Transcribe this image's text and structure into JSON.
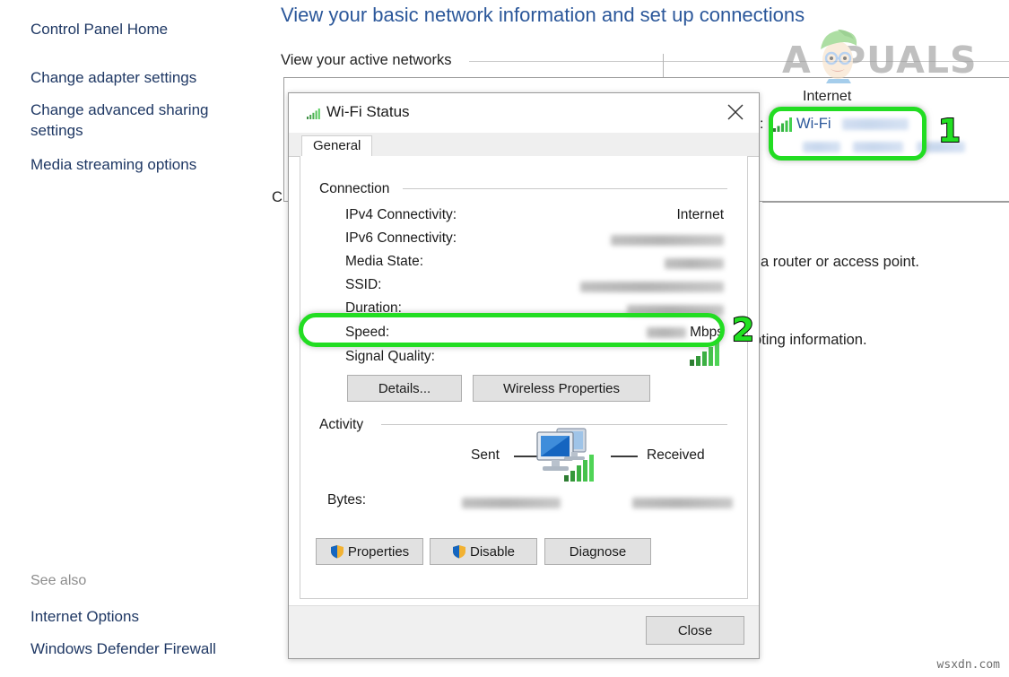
{
  "sidebar": {
    "home_label": "Control Panel Home",
    "links": [
      "Change adapter settings",
      "Change advanced sharing settings",
      "Media streaming options"
    ],
    "see_also_label": "See also",
    "see_also_links": [
      "Internet Options",
      "Windows Defender Firewall"
    ]
  },
  "main": {
    "page_title": "View your basic network information and set up connections",
    "section_heading": "View your active networks",
    "access_type_label": "Internet",
    "connections_colon": ":",
    "wifi_link_label": "Wi-Fi",
    "wifi_name_redacted": "",
    "wifi_sub_redacted": "",
    "behind_dialog_text_1": "a router or access point.",
    "behind_dialog_text_2": "oting information.",
    "left_peek_char": "C"
  },
  "markers": {
    "one": "1",
    "two": "2",
    "color": "#22dd22"
  },
  "dialog": {
    "title": "Wi-Fi Status",
    "title_icon": "wifi-signal-icon",
    "close_icon": "close-icon",
    "tab": "General",
    "groups": {
      "connection": "Connection",
      "activity": "Activity"
    },
    "connection_rows": [
      {
        "label": "IPv4 Connectivity:",
        "value": "Internet",
        "redacted": false
      },
      {
        "label": "IPv6 Connectivity:",
        "value": "",
        "redacted": true
      },
      {
        "label": "Media State:",
        "value": "",
        "redacted": true
      },
      {
        "label": "SSID:",
        "value": "",
        "redacted": true
      },
      {
        "label": "Duration:",
        "value": "",
        "redacted": true
      },
      {
        "label": "Speed:",
        "value": "Mbps",
        "redacted": true
      },
      {
        "label": "Signal Quality:",
        "value": "",
        "redacted": false
      }
    ],
    "buttons": {
      "details": "Details...",
      "wireless_properties": "Wireless Properties",
      "properties": "Properties",
      "disable": "Disable",
      "diagnose": "Diagnose",
      "close": "Close"
    },
    "activity": {
      "sent_label": "Sent",
      "received_label": "Received",
      "bytes_label": "Bytes:",
      "bytes_sent_redacted": "",
      "bytes_received_redacted": ""
    }
  },
  "watermarks": {
    "brand": "APUALS",
    "brand_prefix": "A",
    "brand_suffix": "PUALS",
    "bottom": "wsxdn.com"
  }
}
